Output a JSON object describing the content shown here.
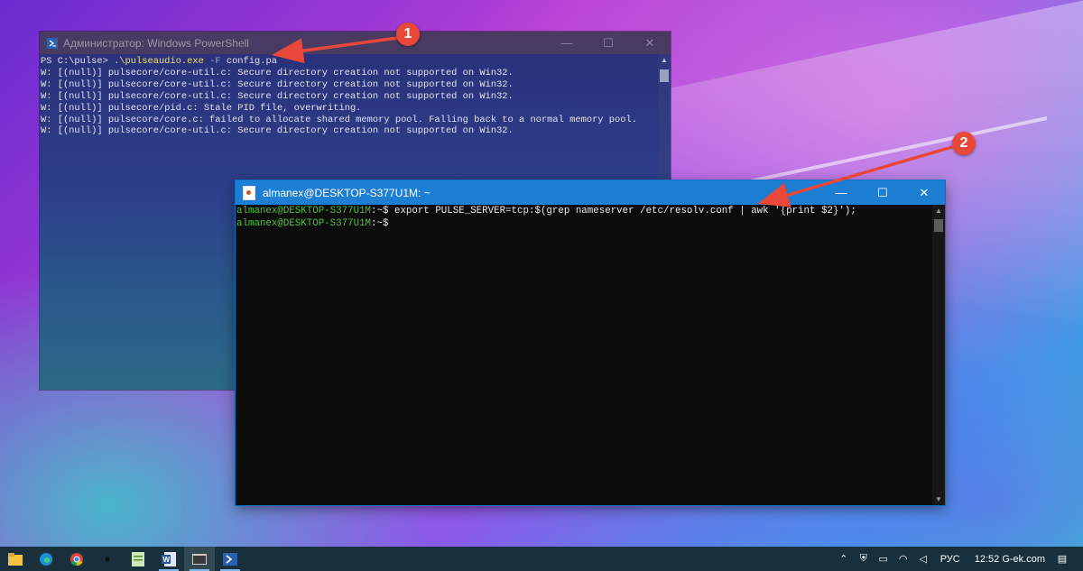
{
  "powershell": {
    "title": "Администратор: Windows PowerShell",
    "prompt": "PS C:\\pulse> ",
    "command": ".\\pulseaudio.exe",
    "flag": "-F",
    "arg": "config.pa",
    "lines": [
      "W: [(null)] pulsecore/core-util.c: Secure directory creation not supported on Win32.",
      "W: [(null)] pulsecore/core-util.c: Secure directory creation not supported on Win32.",
      "W: [(null)] pulsecore/core-util.c: Secure directory creation not supported on Win32.",
      "W: [(null)] pulsecore/pid.c: Stale PID file, overwriting.",
      "W: [(null)] pulsecore/core.c: failed to allocate shared memory pool. Falling back to a normal memory pool.",
      "W: [(null)] pulsecore/core-util.c: Secure directory creation not supported on Win32."
    ],
    "controls": {
      "minimize": "—",
      "maximize": "☐",
      "close": "✕"
    }
  },
  "terminal": {
    "title": "almanex@DESKTOP-S377U1M: ~",
    "prompt_user": "almanex@DESKTOP-S377U1M",
    "prompt_path": ":~$",
    "command": " export PULSE_SERVER=tcp:$(grep nameserver /etc/resolv.conf | awk '{print $2}');",
    "controls": {
      "minimize": "—",
      "maximize": "☐",
      "close": "✕"
    }
  },
  "callouts": {
    "first": "1",
    "second": "2"
  },
  "taskbar": {
    "apps": [
      {
        "icon": "file-explorer-icon",
        "running": false
      },
      {
        "icon": "edge-icon",
        "running": false
      },
      {
        "icon": "chrome-icon",
        "running": false
      },
      {
        "icon": "dot-icon",
        "running": false
      },
      {
        "icon": "notepad-icon",
        "running": false
      },
      {
        "icon": "word-icon",
        "running": true
      },
      {
        "icon": "terminal-icon",
        "running": true,
        "active": true
      },
      {
        "icon": "powershell-icon",
        "running": true
      }
    ],
    "tray": {
      "language": "РУС",
      "time": "12:52",
      "site": "G-ek.com"
    }
  },
  "colors": {
    "callout": "#e8473a",
    "arrow": "#e8473a",
    "terminal_titlebar": "#1d7fd4",
    "prompt_green": "#4ec43a",
    "taskbar": "#17303b"
  }
}
